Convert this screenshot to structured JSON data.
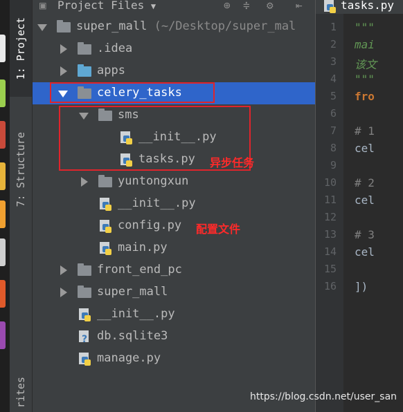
{
  "tool_tabs": {
    "project": "1: Project",
    "structure": "7: Structure",
    "favorites": "rites"
  },
  "panel": {
    "title": "Project Files",
    "dropdown_icon": "triangle-down-icon",
    "toolbar_icons": [
      "target-icon",
      "collapse-icon",
      "gear-icon",
      "hide-icon"
    ]
  },
  "tree": {
    "root": {
      "name": "super_mall",
      "path": "(~/Desktop/super_mal"
    },
    "items": [
      {
        "label": "super_mall",
        "path": " (~/Desktop/super_mal",
        "depth": 0,
        "kind": "folder",
        "expanded": true
      },
      {
        "label": ".idea",
        "depth": 1,
        "kind": "folder",
        "expanded": false
      },
      {
        "label": "apps",
        "depth": 1,
        "kind": "folder-blue",
        "expanded": false
      },
      {
        "label": "celery_tasks",
        "depth": 1,
        "kind": "folder",
        "expanded": true,
        "selected": true
      },
      {
        "label": "sms",
        "depth": 2,
        "kind": "folder",
        "expanded": true
      },
      {
        "label": "__init__.py",
        "depth": 3,
        "kind": "python"
      },
      {
        "label": "tasks.py",
        "depth": 3,
        "kind": "python"
      },
      {
        "label": "yuntongxun",
        "depth": 2,
        "kind": "folder",
        "expanded": false
      },
      {
        "label": "__init__.py",
        "depth": 2,
        "kind": "python"
      },
      {
        "label": "config.py",
        "depth": 2,
        "kind": "python"
      },
      {
        "label": "main.py",
        "depth": 2,
        "kind": "python"
      },
      {
        "label": "front_end_pc",
        "depth": 1,
        "kind": "folder",
        "expanded": false
      },
      {
        "label": "super_mall",
        "depth": 1,
        "kind": "folder",
        "expanded": false
      },
      {
        "label": "__init__.py",
        "depth": 1,
        "kind": "python"
      },
      {
        "label": "db.sqlite3",
        "depth": 1,
        "kind": "db"
      },
      {
        "label": "manage.py",
        "depth": 1,
        "kind": "python"
      }
    ]
  },
  "annotations": {
    "tasks_label": "异步任务",
    "config_label": "配置文件"
  },
  "editor": {
    "tab_title": "tasks.py",
    "line_numbers": [
      "1",
      "2",
      "3",
      "4",
      "5",
      "6",
      "7",
      "8",
      "9",
      "10",
      "11",
      "12",
      "13",
      "14",
      "15",
      "16"
    ],
    "lines": [
      {
        "n": "1",
        "text": "\"\"\"",
        "style": "doc"
      },
      {
        "n": "2",
        "text": "mai",
        "style": "doc"
      },
      {
        "n": "3",
        "text": "该文",
        "style": "doc"
      },
      {
        "n": "4",
        "text": "\"\"\"",
        "style": "doc"
      },
      {
        "n": "5",
        "text": "fro",
        "style": "kw"
      },
      {
        "n": "7",
        "text": "# 1",
        "style": "cm"
      },
      {
        "n": "8",
        "text": "cel",
        "style": "tx"
      },
      {
        "n": "10",
        "text": "# 2",
        "style": "cm"
      },
      {
        "n": "11",
        "text": "cel",
        "style": "tx"
      },
      {
        "n": "13",
        "text": "# 3",
        "style": "cm"
      },
      {
        "n": "14",
        "text": "cel",
        "style": "tx"
      },
      {
        "n": "16",
        "text": "])",
        "style": "tx"
      }
    ]
  },
  "watermark": "https://blog.csdn.net/user_san",
  "colors": {
    "selection": "#2f65ca",
    "annotation": "#e0242b",
    "panel_bg": "#3c3f41",
    "editor_bg": "#2b2b2b"
  }
}
